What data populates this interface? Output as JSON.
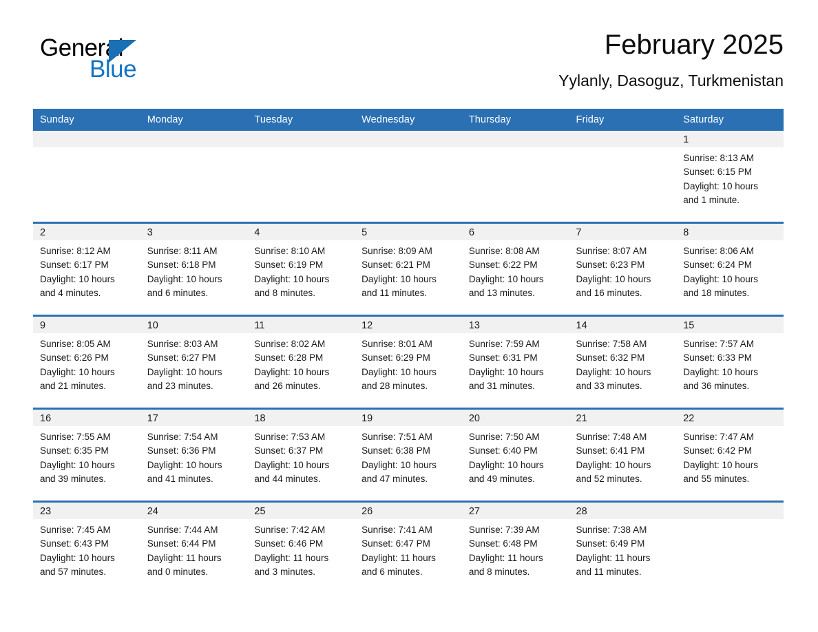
{
  "brand": {
    "name_part1": "General",
    "name_part2": "Blue",
    "triangle_color": "#1a6fb5",
    "blue_color": "#1273c4"
  },
  "header": {
    "title": "February 2025",
    "subtitle": "Yylanly, Dasoguz, Turkmenistan",
    "accent_color": "#2b70b3",
    "band_color": "#f1f1f1"
  },
  "weekdays": [
    "Sunday",
    "Monday",
    "Tuesday",
    "Wednesday",
    "Thursday",
    "Friday",
    "Saturday"
  ],
  "weeks": [
    [
      {
        "day": "",
        "sunrise": "",
        "sunset": "",
        "daylight_line1": "",
        "daylight_line2": ""
      },
      {
        "day": "",
        "sunrise": "",
        "sunset": "",
        "daylight_line1": "",
        "daylight_line2": ""
      },
      {
        "day": "",
        "sunrise": "",
        "sunset": "",
        "daylight_line1": "",
        "daylight_line2": ""
      },
      {
        "day": "",
        "sunrise": "",
        "sunset": "",
        "daylight_line1": "",
        "daylight_line2": ""
      },
      {
        "day": "",
        "sunrise": "",
        "sunset": "",
        "daylight_line1": "",
        "daylight_line2": ""
      },
      {
        "day": "",
        "sunrise": "",
        "sunset": "",
        "daylight_line1": "",
        "daylight_line2": ""
      },
      {
        "day": "1",
        "sunrise": "Sunrise: 8:13 AM",
        "sunset": "Sunset: 6:15 PM",
        "daylight_line1": "Daylight: 10 hours",
        "daylight_line2": "and 1 minute."
      }
    ],
    [
      {
        "day": "2",
        "sunrise": "Sunrise: 8:12 AM",
        "sunset": "Sunset: 6:17 PM",
        "daylight_line1": "Daylight: 10 hours",
        "daylight_line2": "and 4 minutes."
      },
      {
        "day": "3",
        "sunrise": "Sunrise: 8:11 AM",
        "sunset": "Sunset: 6:18 PM",
        "daylight_line1": "Daylight: 10 hours",
        "daylight_line2": "and 6 minutes."
      },
      {
        "day": "4",
        "sunrise": "Sunrise: 8:10 AM",
        "sunset": "Sunset: 6:19 PM",
        "daylight_line1": "Daylight: 10 hours",
        "daylight_line2": "and 8 minutes."
      },
      {
        "day": "5",
        "sunrise": "Sunrise: 8:09 AM",
        "sunset": "Sunset: 6:21 PM",
        "daylight_line1": "Daylight: 10 hours",
        "daylight_line2": "and 11 minutes."
      },
      {
        "day": "6",
        "sunrise": "Sunrise: 8:08 AM",
        "sunset": "Sunset: 6:22 PM",
        "daylight_line1": "Daylight: 10 hours",
        "daylight_line2": "and 13 minutes."
      },
      {
        "day": "7",
        "sunrise": "Sunrise: 8:07 AM",
        "sunset": "Sunset: 6:23 PM",
        "daylight_line1": "Daylight: 10 hours",
        "daylight_line2": "and 16 minutes."
      },
      {
        "day": "8",
        "sunrise": "Sunrise: 8:06 AM",
        "sunset": "Sunset: 6:24 PM",
        "daylight_line1": "Daylight: 10 hours",
        "daylight_line2": "and 18 minutes."
      }
    ],
    [
      {
        "day": "9",
        "sunrise": "Sunrise: 8:05 AM",
        "sunset": "Sunset: 6:26 PM",
        "daylight_line1": "Daylight: 10 hours",
        "daylight_line2": "and 21 minutes."
      },
      {
        "day": "10",
        "sunrise": "Sunrise: 8:03 AM",
        "sunset": "Sunset: 6:27 PM",
        "daylight_line1": "Daylight: 10 hours",
        "daylight_line2": "and 23 minutes."
      },
      {
        "day": "11",
        "sunrise": "Sunrise: 8:02 AM",
        "sunset": "Sunset: 6:28 PM",
        "daylight_line1": "Daylight: 10 hours",
        "daylight_line2": "and 26 minutes."
      },
      {
        "day": "12",
        "sunrise": "Sunrise: 8:01 AM",
        "sunset": "Sunset: 6:29 PM",
        "daylight_line1": "Daylight: 10 hours",
        "daylight_line2": "and 28 minutes."
      },
      {
        "day": "13",
        "sunrise": "Sunrise: 7:59 AM",
        "sunset": "Sunset: 6:31 PM",
        "daylight_line1": "Daylight: 10 hours",
        "daylight_line2": "and 31 minutes."
      },
      {
        "day": "14",
        "sunrise": "Sunrise: 7:58 AM",
        "sunset": "Sunset: 6:32 PM",
        "daylight_line1": "Daylight: 10 hours",
        "daylight_line2": "and 33 minutes."
      },
      {
        "day": "15",
        "sunrise": "Sunrise: 7:57 AM",
        "sunset": "Sunset: 6:33 PM",
        "daylight_line1": "Daylight: 10 hours",
        "daylight_line2": "and 36 minutes."
      }
    ],
    [
      {
        "day": "16",
        "sunrise": "Sunrise: 7:55 AM",
        "sunset": "Sunset: 6:35 PM",
        "daylight_line1": "Daylight: 10 hours",
        "daylight_line2": "and 39 minutes."
      },
      {
        "day": "17",
        "sunrise": "Sunrise: 7:54 AM",
        "sunset": "Sunset: 6:36 PM",
        "daylight_line1": "Daylight: 10 hours",
        "daylight_line2": "and 41 minutes."
      },
      {
        "day": "18",
        "sunrise": "Sunrise: 7:53 AM",
        "sunset": "Sunset: 6:37 PM",
        "daylight_line1": "Daylight: 10 hours",
        "daylight_line2": "and 44 minutes."
      },
      {
        "day": "19",
        "sunrise": "Sunrise: 7:51 AM",
        "sunset": "Sunset: 6:38 PM",
        "daylight_line1": "Daylight: 10 hours",
        "daylight_line2": "and 47 minutes."
      },
      {
        "day": "20",
        "sunrise": "Sunrise: 7:50 AM",
        "sunset": "Sunset: 6:40 PM",
        "daylight_line1": "Daylight: 10 hours",
        "daylight_line2": "and 49 minutes."
      },
      {
        "day": "21",
        "sunrise": "Sunrise: 7:48 AM",
        "sunset": "Sunset: 6:41 PM",
        "daylight_line1": "Daylight: 10 hours",
        "daylight_line2": "and 52 minutes."
      },
      {
        "day": "22",
        "sunrise": "Sunrise: 7:47 AM",
        "sunset": "Sunset: 6:42 PM",
        "daylight_line1": "Daylight: 10 hours",
        "daylight_line2": "and 55 minutes."
      }
    ],
    [
      {
        "day": "23",
        "sunrise": "Sunrise: 7:45 AM",
        "sunset": "Sunset: 6:43 PM",
        "daylight_line1": "Daylight: 10 hours",
        "daylight_line2": "and 57 minutes."
      },
      {
        "day": "24",
        "sunrise": "Sunrise: 7:44 AM",
        "sunset": "Sunset: 6:44 PM",
        "daylight_line1": "Daylight: 11 hours",
        "daylight_line2": "and 0 minutes."
      },
      {
        "day": "25",
        "sunrise": "Sunrise: 7:42 AM",
        "sunset": "Sunset: 6:46 PM",
        "daylight_line1": "Daylight: 11 hours",
        "daylight_line2": "and 3 minutes."
      },
      {
        "day": "26",
        "sunrise": "Sunrise: 7:41 AM",
        "sunset": "Sunset: 6:47 PM",
        "daylight_line1": "Daylight: 11 hours",
        "daylight_line2": "and 6 minutes."
      },
      {
        "day": "27",
        "sunrise": "Sunrise: 7:39 AM",
        "sunset": "Sunset: 6:48 PM",
        "daylight_line1": "Daylight: 11 hours",
        "daylight_line2": "and 8 minutes."
      },
      {
        "day": "28",
        "sunrise": "Sunrise: 7:38 AM",
        "sunset": "Sunset: 6:49 PM",
        "daylight_line1": "Daylight: 11 hours",
        "daylight_line2": "and 11 minutes."
      },
      {
        "day": "",
        "sunrise": "",
        "sunset": "",
        "daylight_line1": "",
        "daylight_line2": ""
      }
    ]
  ]
}
